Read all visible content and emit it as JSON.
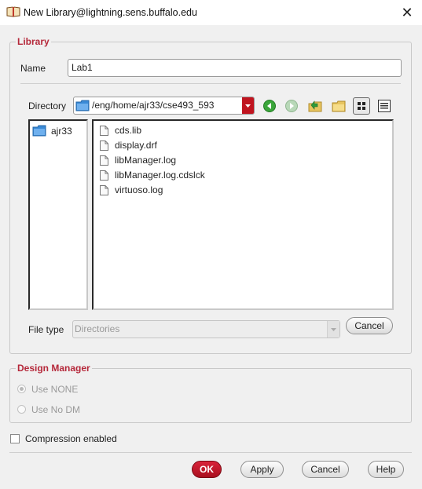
{
  "window": {
    "title": "New Library@lightning.sens.buffalo.edu",
    "close_glyph": "✕"
  },
  "library_group": {
    "legend": "Library",
    "name_label": "Name",
    "name_value": "Lab1",
    "directory_label": "Directory",
    "directory_path": "/eng/home/ajr33/cse493_593",
    "toolbar_icons": [
      "back-icon",
      "forward-icon",
      "parent-folder-icon",
      "new-folder-icon",
      "icon-view-icon",
      "list-view-icon"
    ],
    "tree": [
      {
        "label": "ajr33"
      }
    ],
    "files": [
      {
        "name": "cds.lib"
      },
      {
        "name": "display.drf"
      },
      {
        "name": "libManager.log"
      },
      {
        "name": "libManager.log.cdslck"
      },
      {
        "name": "virtuoso.log"
      }
    ],
    "file_type_label": "File type",
    "file_type_value": "Directories",
    "cancel_label": "Cancel"
  },
  "design_manager_group": {
    "legend": "Design Manager",
    "options": [
      {
        "label": "Use NONE",
        "checked": true
      },
      {
        "label": "Use No DM",
        "checked": false
      }
    ]
  },
  "compression": {
    "label": "Compression enabled",
    "checked": false
  },
  "footer": {
    "ok": "OK",
    "apply": "Apply",
    "cancel": "Cancel",
    "help": "Help"
  },
  "colors": {
    "accent": "#b5283a",
    "ok_button": "#c01a2c",
    "folder": "#3a8ad6"
  }
}
